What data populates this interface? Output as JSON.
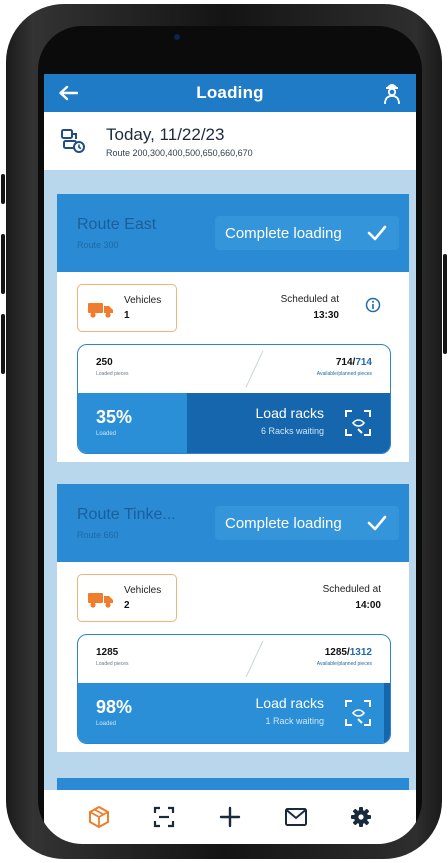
{
  "header": {
    "title": "Loading"
  },
  "today": {
    "date": "Today, 11/22/23",
    "routes": "Route 200,300,400,500,650,660,670"
  },
  "cards": [
    {
      "route_name": "Route East",
      "route_number": "Route 300",
      "complete_label": "Complete loading",
      "vehicles_label": "Vehicles",
      "vehicles_count": "1",
      "scheduled_label": "Scheduled at",
      "scheduled_time": "13:30",
      "loaded_pieces": "250",
      "loaded_pieces_label": "Loaded pieces",
      "available": "714",
      "planned": "714",
      "available_label": "Available/planned pieces",
      "percent_text": "35%",
      "percent_label": "Loaded",
      "progress": 0.35,
      "racks_label": "Load racks",
      "racks_waiting": "6 Racks waiting"
    },
    {
      "route_name": "Route Tinke...",
      "route_number": "Route 660",
      "complete_label": "Complete loading",
      "vehicles_label": "Vehicles",
      "vehicles_count": "2",
      "scheduled_label": "Scheduled at",
      "scheduled_time": "14:00",
      "loaded_pieces": "1285",
      "loaded_pieces_label": "Loaded pieces",
      "available": "1285",
      "planned": "1312",
      "available_label": "Available/planned pieces",
      "percent_text": "98%",
      "percent_label": "Loaded",
      "progress": 0.98,
      "racks_label": "Load racks",
      "racks_waiting": "1 Rack waiting"
    }
  ],
  "nav": {
    "items": [
      {
        "icon": "box-icon",
        "active": true
      },
      {
        "icon": "scan-icon",
        "active": false
      },
      {
        "icon": "plus-icon",
        "active": false
      },
      {
        "icon": "mail-icon",
        "active": false
      },
      {
        "icon": "gear-icon",
        "active": false
      }
    ]
  },
  "colors": {
    "primary": "#1f7bc6",
    "accent": "#f07c2d",
    "progress_dark": "#1566ad",
    "list_bg": "#b8d6ec"
  }
}
